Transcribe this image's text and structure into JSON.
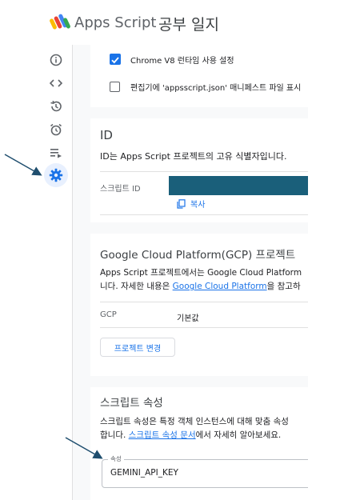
{
  "header": {
    "app_name": "Apps Script",
    "project_name": "공부 일지"
  },
  "sidebar": {
    "items": [
      {
        "name": "overview",
        "icon": "info-icon"
      },
      {
        "name": "editor",
        "icon": "code-icon"
      },
      {
        "name": "triggers-history",
        "icon": "history-icon"
      },
      {
        "name": "triggers",
        "icon": "alarm-icon"
      },
      {
        "name": "executions",
        "icon": "playlist-play-icon"
      },
      {
        "name": "settings",
        "icon": "gear-icon",
        "active": true
      }
    ]
  },
  "settings": {
    "chrome_v8": {
      "label": "Chrome V8 런타임 사용 설정",
      "checked": true
    },
    "show_manifest": {
      "label": "편집기에 'appsscript.json' 매니페스트 파일 표시",
      "checked": false
    }
  },
  "ids": {
    "heading": "ID",
    "description": "ID는 Apps Script 프로젝트의 고유 식별자입니다.",
    "script_id_label": "스크립트 ID",
    "copy_label": "복사"
  },
  "gcp": {
    "heading": "Google Cloud Platform(GCP) 프로젝트",
    "desc_line1": "Apps Script 프로젝트에서는 Google Cloud Platform",
    "desc_line2_prefix": "니다. 자세한 내용은 ",
    "desc_link": "Google Cloud Platform",
    "desc_line2_suffix": "을 참고하",
    "label": "GCP",
    "value": "기본값",
    "change_button": "프로젝트 변경"
  },
  "script_props": {
    "heading": "스크립트 속성",
    "desc_line1": "스크립트 속성은 특정 객체 인스턴스에 대해 맞춤 속성",
    "desc_line2_prefix": "합니다. ",
    "desc_link": "스크립트 속성 문서",
    "desc_line2_suffix": "에서 자세히 알아보세요.",
    "field_label": "속성",
    "field_value": "GEMINI_API_KEY"
  },
  "colors": {
    "accent": "#1a73e8",
    "redacted": "#1a5f7a",
    "arrow": "#1f4e6e"
  }
}
